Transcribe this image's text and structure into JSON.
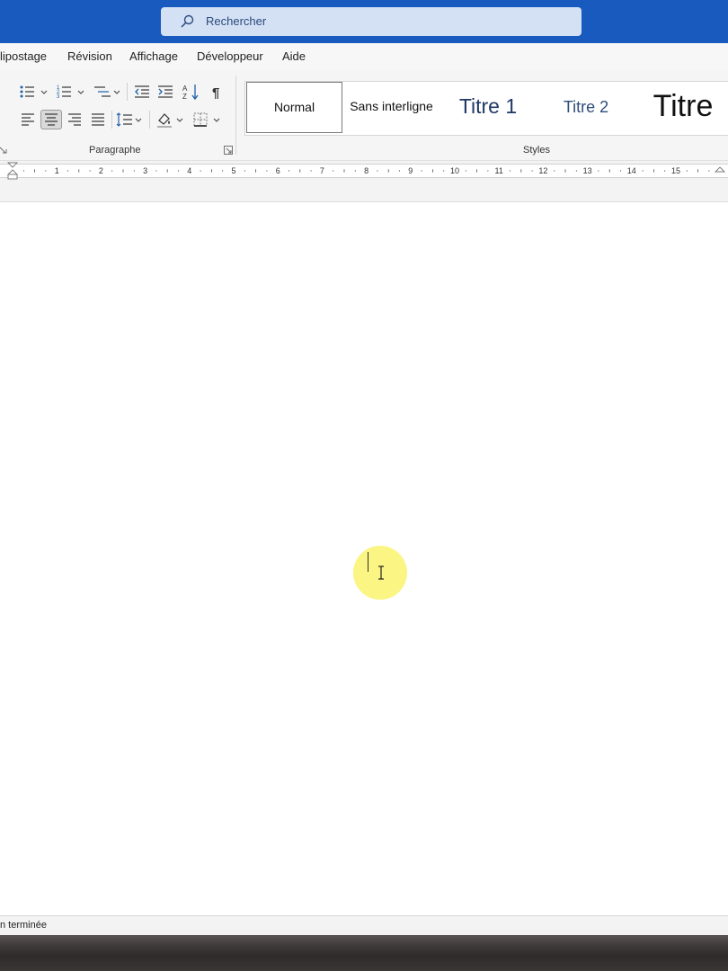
{
  "titlebar": {
    "search_placeholder": "Rechercher"
  },
  "menu": {
    "tabs": [
      "lipostage",
      "Révision",
      "Affichage",
      "Développeur",
      "Aide"
    ]
  },
  "ribbon": {
    "paragraph_label": "Paragraphe",
    "styles_label": "Styles",
    "styles": [
      "Normal",
      "Sans interligne",
      "Titre 1",
      "Titre 2",
      "Titre"
    ]
  },
  "ruler": {
    "numbers": [
      "1",
      "2",
      "3",
      "4",
      "5",
      "6",
      "7",
      "8",
      "9",
      "10",
      "11",
      "12",
      "13",
      "14",
      "15"
    ]
  },
  "status": {
    "text": "n terminée"
  },
  "icons": {
    "search": "search-icon",
    "bullets": "bullet-list-icon",
    "numbering": "numbered-list-icon",
    "multilevel": "multilevel-list-icon",
    "decrease_indent": "decrease-indent-icon",
    "increase_indent": "increase-indent-icon",
    "sort": "sort-icon",
    "pilcrow": "pilcrow-icon",
    "align_left": "align-left-icon",
    "align_center": "align-center-icon",
    "align_right": "align-right-icon",
    "justify": "justify-icon",
    "line_spacing": "line-spacing-icon",
    "shading": "shading-icon",
    "borders": "borders-icon"
  },
  "colors": {
    "titlebar": "#185abd",
    "search_bg": "#d4e1f5",
    "heading": "#1f3864",
    "cursor_highlight": "#fbf584"
  }
}
